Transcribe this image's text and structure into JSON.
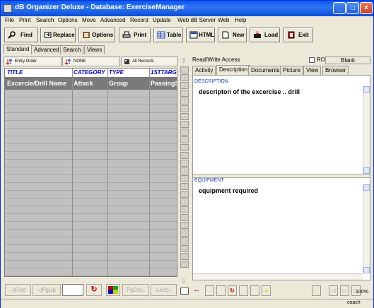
{
  "window": {
    "title": "dB Organizer Deluxe - Database: ExerciseManager",
    "controls": [
      "_",
      "□",
      "×"
    ]
  },
  "menu": [
    "File",
    "Print",
    "Search",
    "Options",
    "Move",
    "Advanced",
    "Record",
    "Update",
    "Web dB Server",
    "Web",
    "Help"
  ],
  "toolbar": {
    "find": "Find",
    "replace": "Replace",
    "options": "Options",
    "print": "Print",
    "table": "Table",
    "html": "HTML",
    "new": "New",
    "load": "Load",
    "exit": "Exit"
  },
  "search_tabs": [
    "Standard",
    "Advanced",
    "Search",
    "Views"
  ],
  "sort_bar": {
    "order": "Entry Order",
    "filter": "NONE",
    "records": "All Records"
  },
  "grid": {
    "headers": [
      "TITLE",
      "CATEGORY",
      "TYPE",
      "1STTARG"
    ],
    "first_row": [
      "Excercie/Drill Name",
      "Attack",
      "Group",
      "PassingS"
    ]
  },
  "nav": {
    "first": "First",
    "pgup": "PgUp",
    "pgdn": "PgDn",
    "last": "Last"
  },
  "alphabet": [
    "A",
    "B",
    "C",
    "D",
    "E",
    "F",
    "G",
    "H",
    "I",
    "J",
    "K",
    "L",
    "M",
    "N",
    "O",
    "P",
    "Q",
    "R",
    "S",
    "T",
    "U",
    "V",
    "W",
    "X",
    "Y",
    "Z"
  ],
  "record": {
    "access": "Read/Write Access",
    "ro_label": "RO",
    "blank_button": "Blank",
    "tabs": [
      "Activity",
      "Description",
      "Documents",
      "Picture",
      "View",
      "Browser"
    ],
    "active_tab": "Description"
  },
  "fields": {
    "description_label": "DESCRIPTION",
    "description_value": "descripton of the excercise .. drill",
    "equipment_label": "EQUIPMENT",
    "equipment_value": "equipment required"
  },
  "status": {
    "zoom": "100%",
    "user": "coach"
  },
  "colors": {
    "titlebar": "#0a58f0",
    "header_text": "#0000c0",
    "field_label": "#1a3fb8",
    "grid_bg": "#c0c0c0",
    "grid_row": "#7a7a7a"
  }
}
